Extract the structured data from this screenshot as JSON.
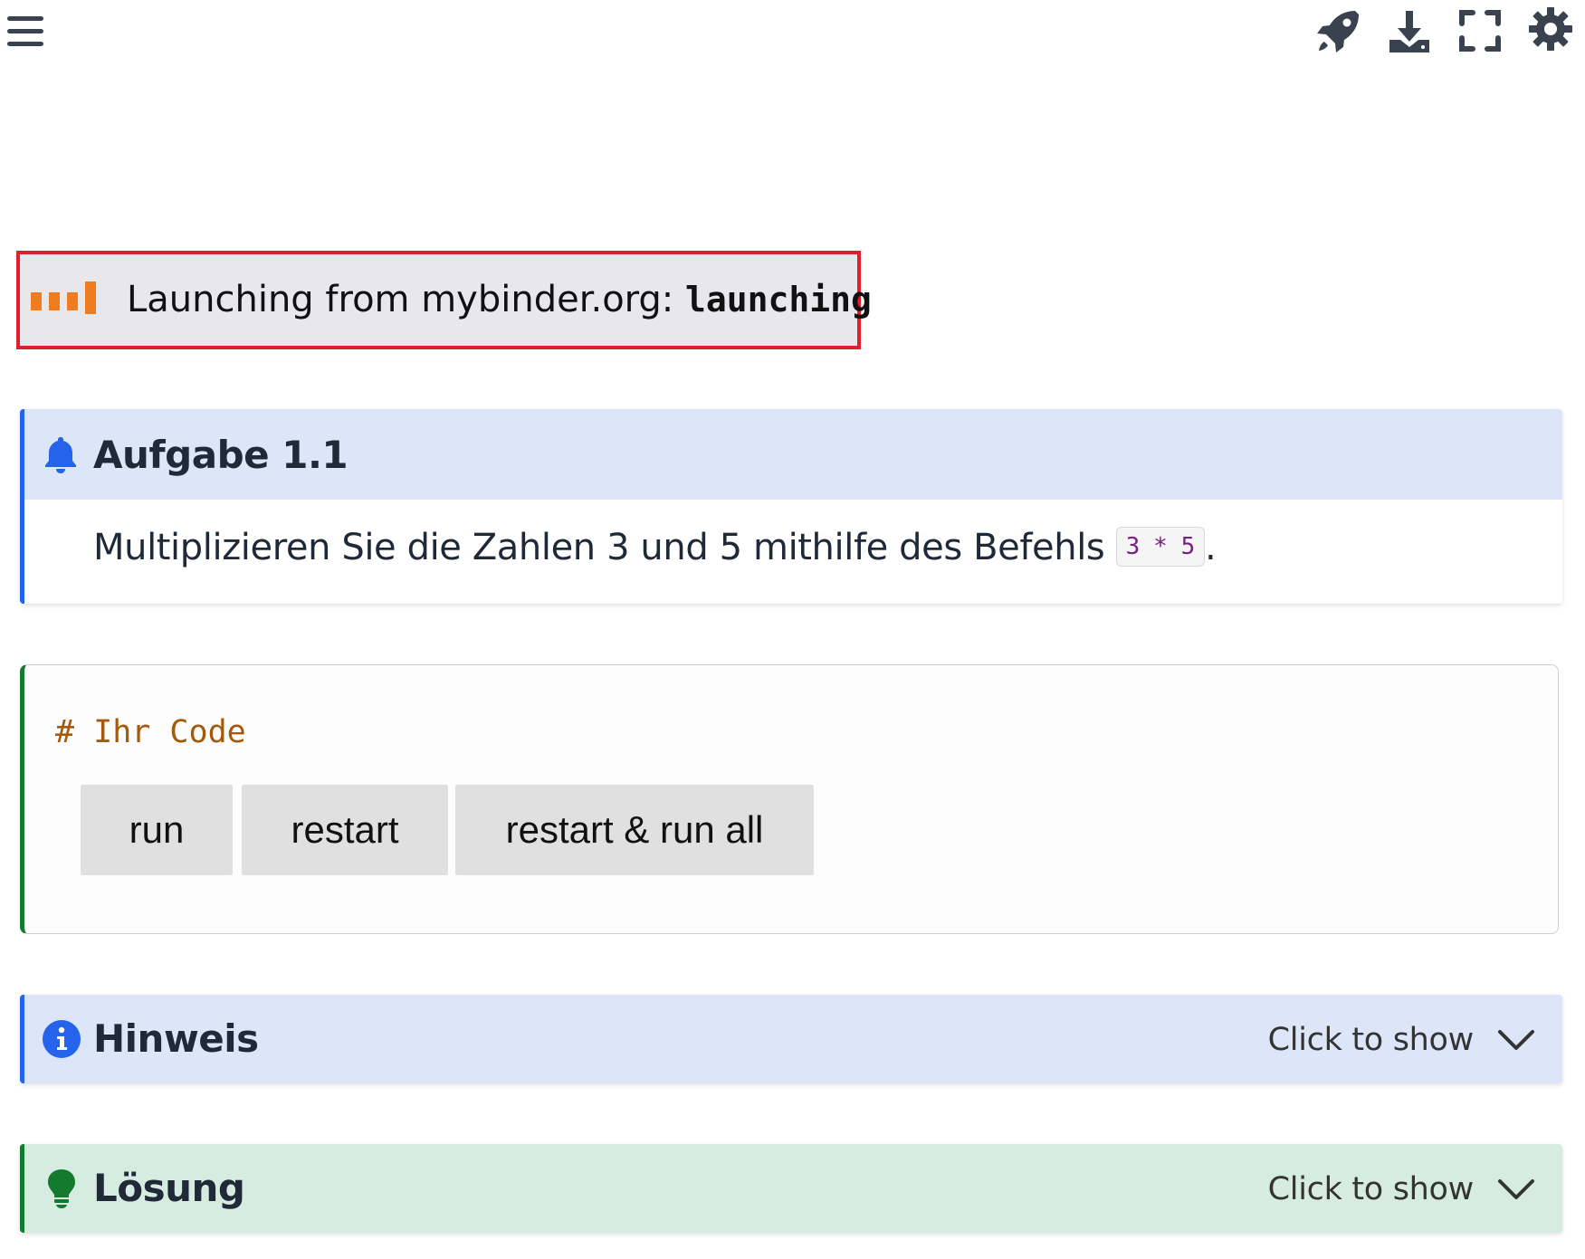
{
  "topbar": {
    "menu_icon": "hamburger-menu-icon",
    "actions": [
      {
        "name": "launch",
        "icon": "rocket-icon"
      },
      {
        "name": "download",
        "icon": "download-icon"
      },
      {
        "name": "fullscreen",
        "icon": "fullscreen-icon"
      },
      {
        "name": "settings",
        "icon": "gear-icon"
      }
    ],
    "icon_color": "#3a4250"
  },
  "binder_status": {
    "logo_icon": "binder-logo-icon",
    "prefix": "Launching from mybinder.org: ",
    "state": "launching",
    "border_color": "#e11d2e",
    "logo_color": "#f07c20"
  },
  "task": {
    "icon": "bell-icon",
    "title": "Aufgabe 1.1",
    "body_text": "Multiplizieren Sie die Zahlen 3 und 5 mithilfe des Befehls ",
    "code": "3 * 5",
    "body_suffix": ".",
    "accent": "#2563eb"
  },
  "code_cell": {
    "code": "# Ihr Code",
    "buttons": {
      "run": "run",
      "restart": "restart",
      "restart_run_all": "restart & run all"
    },
    "accent": "#137a2e"
  },
  "hint": {
    "icon": "info-icon",
    "title": "Hinweis",
    "toggle_label": "Click to show"
  },
  "solution": {
    "icon": "lightbulb-icon",
    "title": "Lösung",
    "toggle_label": "Click to show"
  }
}
